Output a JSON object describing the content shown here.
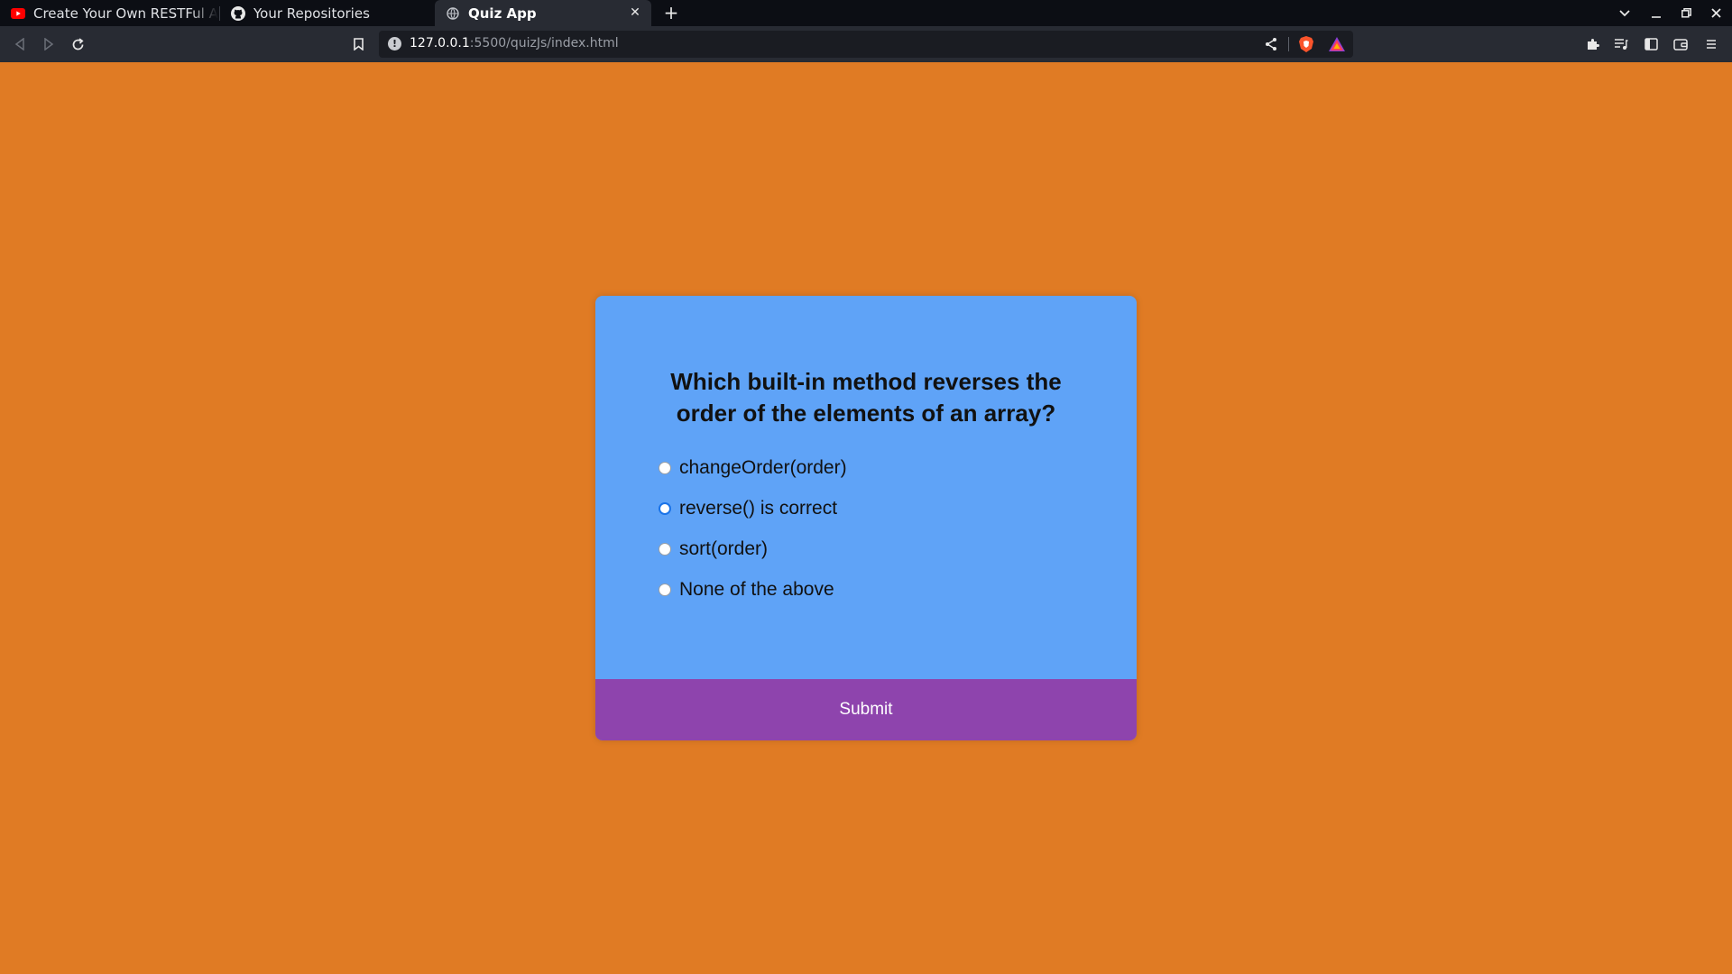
{
  "browser": {
    "tabs": [
      {
        "title": "Create Your Own RESTFul API",
        "icon": "youtube-icon"
      },
      {
        "title": "Your Repositories",
        "icon": "github-icon"
      },
      {
        "title": "Quiz App",
        "icon": "globe-icon",
        "active": true
      }
    ],
    "url": {
      "host": "127.0.0.1",
      "path": ":5500/quizJs/index.html"
    }
  },
  "quiz": {
    "question": "Which built-in method reverses the order of the elements of an array?",
    "answers": [
      {
        "label": "changeOrder(order)",
        "selected": false
      },
      {
        "label": "reverse() is correct",
        "selected": true
      },
      {
        "label": "sort(order)",
        "selected": false
      },
      {
        "label": "None of the above",
        "selected": false
      }
    ],
    "submit_label": "Submit"
  },
  "colors": {
    "page_background": "#e07b24",
    "card_background": "#5fa3f7",
    "submit_background": "#8e44ad"
  }
}
